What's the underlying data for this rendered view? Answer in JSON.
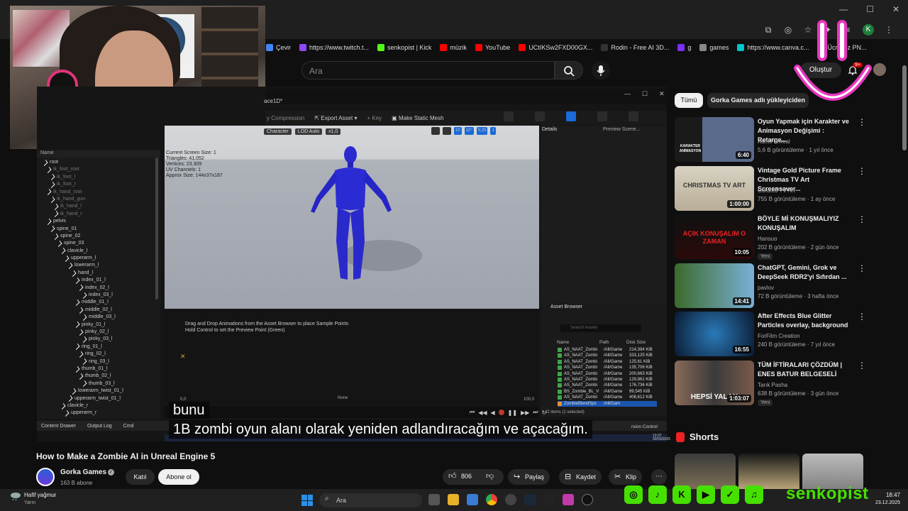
{
  "browser": {
    "bookmarks": [
      {
        "label": "Çevir",
        "color": "#4285f4"
      },
      {
        "label": "https://www.twitch.t...",
        "color": "#9146ff"
      },
      {
        "label": "senkopist | Kick",
        "color": "#53fc18"
      },
      {
        "label": "müzik",
        "color": "#ff0000"
      },
      {
        "label": "YouTube",
        "color": "#ff0000"
      },
      {
        "label": "UCtIKSw2FXD00GX...",
        "color": "#ff0000"
      },
      {
        "label": "Rodin - Free AI 3D...",
        "color": "#333333"
      },
      {
        "label": "g",
        "color": "#7b2ff7"
      },
      {
        "label": "games",
        "color": "#888888"
      },
      {
        "label": "https://www.canva.c...",
        "color": "#00c4cc"
      },
      {
        "label": "Ücretsiz PN...",
        "color": "#cc3333"
      }
    ],
    "profile_initial": "K"
  },
  "youtube": {
    "search_placeholder": "Ara",
    "create_label": "Oluştur",
    "notif_count": "9+",
    "chips": {
      "all": "Tümü",
      "uploader": "Gorka Games adlı yükleyiciden"
    },
    "video_title": "How to Make a Zombie AI in Unreal Engine 5",
    "channel": {
      "name": "Gorka Games",
      "subs": "163 B abone",
      "join": "Katıl",
      "subscribe": "Abone ol"
    },
    "actions": {
      "likes": "806",
      "share": "Paylaş",
      "save": "Kaydet",
      "clip": "Klip"
    },
    "captions": {
      "line1": "bunu",
      "line2": "1B zombi oyun alanı olarak yeniden adlandıracağım ve açacağım."
    },
    "recommendations": [
      {
        "title": "Oyun Yapmak için Karakter ve Animasyon Değişimi : Retarge...",
        "channel": "Kamil Unreal",
        "meta": "5,6 B görüntüleme · 1 yıl önce",
        "duration": "6:40",
        "new": ""
      },
      {
        "title": "Vintage Gold Picture Frame Christmas TV Art Screensaver...",
        "channel": "Curated TV Art",
        "meta": "755 B görüntüleme · 1 ay önce",
        "duration": "1:00:00",
        "new": ""
      },
      {
        "title": "BÖYLE Mİ KONUŞMALIYIZ KONUŞALIM",
        "channel": "Hansuo",
        "meta": "202 B görüntüleme · 2 gün önce",
        "duration": "10:05",
        "new": "Yeni"
      },
      {
        "title": "ChatGPT, Gemini, Grok ve DeepSeek RDR2'yi Sıfırdan ...",
        "channel": "pavlov",
        "meta": "72 B görüntüleme · 3 hafta önce",
        "duration": "14:41",
        "new": ""
      },
      {
        "title": "After Effects Blue Glitter Particles overlay, background",
        "channel": "ForFilm Creation",
        "meta": "240 B görüntüleme · 7 yıl önce",
        "duration": "16:55",
        "new": ""
      },
      {
        "title": "TÜM İFTİRALARI ÇÖZDÜM | ENES BATUR BELGESELİ",
        "channel": "Tarık Pasha",
        "meta": "638 B görüntüleme · 3 gün önce",
        "duration": "1:03:07",
        "new": "Yeni"
      }
    ],
    "thumb_texts": {
      "t1": "KARAKTER ANİMASYON",
      "t2": "CHRISTMAS TV ART",
      "t3": "AÇIK KONUŞALIM O ZAMAN",
      "t6": "HEPSİ YALAN"
    },
    "shorts_title": "Shorts"
  },
  "unreal": {
    "tab": "ace1D*",
    "toolbar": {
      "compression": "y Compression",
      "export": "Export Asset",
      "key": "Key",
      "static_mesh": "Make Static Mesh"
    },
    "viewport_pills": [
      "Character",
      "LOD Auto",
      "x1,0"
    ],
    "viewport_icons": [
      "10",
      "10°",
      "0,25",
      "1"
    ],
    "stats": [
      "Current Screen Size: 1",
      "Triangles: 41.052",
      "Vertices: 23.309",
      "UV Channels: 1",
      "Approx Size: 144x37x187"
    ],
    "bone_header": "Name",
    "bones": [
      {
        "name": "root",
        "indent": 0,
        "dim": false
      },
      {
        "name": "ik_foot_root",
        "indent": 1,
        "dim": true
      },
      {
        "name": "ik_foot_l",
        "indent": 2,
        "dim": true
      },
      {
        "name": "ik_foot_r",
        "indent": 2,
        "dim": true
      },
      {
        "name": "ik_hand_root",
        "indent": 1,
        "dim": true
      },
      {
        "name": "ik_hand_gun",
        "indent": 2,
        "dim": true
      },
      {
        "name": "ik_hand_l",
        "indent": 3,
        "dim": true
      },
      {
        "name": "ik_hand_r",
        "indent": 3,
        "dim": true
      },
      {
        "name": "pelvis",
        "indent": 1,
        "dim": false
      },
      {
        "name": "spine_01",
        "indent": 2,
        "dim": false
      },
      {
        "name": "spine_02",
        "indent": 3,
        "dim": false
      },
      {
        "name": "spine_03",
        "indent": 4,
        "dim": false
      },
      {
        "name": "clavicle_l",
        "indent": 5,
        "dim": false
      },
      {
        "name": "upperarm_l",
        "indent": 6,
        "dim": false
      },
      {
        "name": "lowerarm_l",
        "indent": 7,
        "dim": false
      },
      {
        "name": "hand_l",
        "indent": 8,
        "dim": false
      },
      {
        "name": "index_01_l",
        "indent": 9,
        "dim": false
      },
      {
        "name": "index_02_l",
        "indent": 10,
        "dim": false
      },
      {
        "name": "index_03_l",
        "indent": 11,
        "dim": false
      },
      {
        "name": "middle_01_l",
        "indent": 9,
        "dim": false
      },
      {
        "name": "middle_02_l",
        "indent": 10,
        "dim": false
      },
      {
        "name": "middle_03_l",
        "indent": 11,
        "dim": false
      },
      {
        "name": "pinky_01_l",
        "indent": 9,
        "dim": false
      },
      {
        "name": "pinky_02_l",
        "indent": 10,
        "dim": false
      },
      {
        "name": "pinky_03_l",
        "indent": 11,
        "dim": false
      },
      {
        "name": "ring_01_l",
        "indent": 9,
        "dim": false
      },
      {
        "name": "ring_02_l",
        "indent": 10,
        "dim": false
      },
      {
        "name": "ring_03_l",
        "indent": 11,
        "dim": false
      },
      {
        "name": "thumb_01_l",
        "indent": 9,
        "dim": false
      },
      {
        "name": "thumb_02_l",
        "indent": 10,
        "dim": false
      },
      {
        "name": "thumb_03_l",
        "indent": 11,
        "dim": false
      },
      {
        "name": "lowerarm_twist_01_l",
        "indent": 8,
        "dim": false
      },
      {
        "name": "upperarm_twist_01_l",
        "indent": 7,
        "dim": false
      },
      {
        "name": "clavicle_r",
        "indent": 5,
        "dim": false
      },
      {
        "name": "upperarm_r",
        "indent": 6,
        "dim": false
      }
    ],
    "details_tab": "Details",
    "preview_tab": "Preview Scene...",
    "blend_text": [
      "Drag and Drop Animations from the Asset Browser to place Sample Points",
      "Hold Control to set the Preview Point (Green)"
    ],
    "blend_axis": {
      "none": "None",
      "min": "0,0",
      "max": "100,0"
    },
    "asset_browser": {
      "title": "Asset Browser",
      "search_placeholder": "Search Assets",
      "columns": [
        "Name",
        "Path",
        "Disk Size"
      ],
      "rows": [
        {
          "name": "AS_NAAT_Zombi",
          "path": "/All/Game",
          "size": "214,394 KiB",
          "selected": false
        },
        {
          "name": "AS_NAAT_Zombi",
          "path": "/All/Game",
          "size": "333,125 KiB",
          "selected": false
        },
        {
          "name": "AS_NAAT_Zombi",
          "path": "/All/Game",
          "size": "125,61 KiB",
          "selected": false
        },
        {
          "name": "AS_NAAT_Zombi",
          "path": "/All/Game",
          "size": "135,706 KiB",
          "selected": false
        },
        {
          "name": "AS_NAAT_Zombi",
          "path": "/All/Game",
          "size": "200,663 KiB",
          "selected": false
        },
        {
          "name": "AS_NAAT_Zombi",
          "path": "/All/Game",
          "size": "129,861 KiB",
          "selected": false
        },
        {
          "name": "AS_NAAT_Zombi",
          "path": "/All/Game",
          "size": "176,736 KiB",
          "selected": false
        },
        {
          "name": "BS_Zombie_BL_V",
          "path": "/All/Game",
          "size": "99,545 KiB",
          "selected": false
        },
        {
          "name": "AS_NAAT_Zombi",
          "path": "/All/Game",
          "size": "408,612 KiB",
          "selected": false
        },
        {
          "name": "ZombieBlendSps",
          "path": "/All/Gam",
          "size": "",
          "selected": true
        }
      ],
      "count": "42 items (1 selected)"
    },
    "bottom": {
      "drawer": "Content Drawer",
      "log": "Output Log",
      "cmd": "Cmd",
      "rev": "rsion Control"
    },
    "ue_clock": {
      "time": "13:37",
      "date": "30/03/2025"
    }
  },
  "taskbar": {
    "weather": "Hafif yağmur",
    "weather_sub": "Yarın",
    "search": "Ara",
    "time": "18:47",
    "date": "23.12.2025"
  },
  "overlay": {
    "handle": "senkopist",
    "accent": "#46e000",
    "smile_color": "#e936c0"
  }
}
